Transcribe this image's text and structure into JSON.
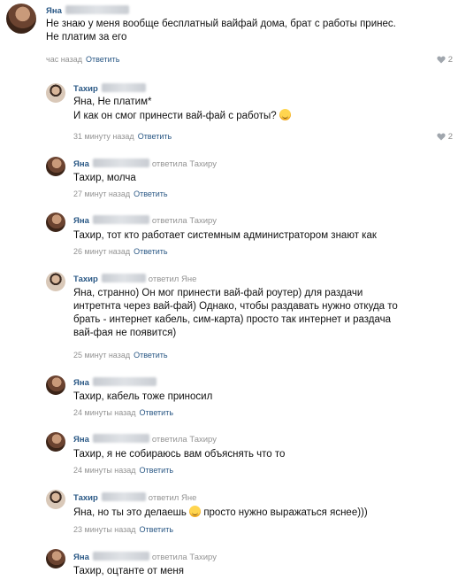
{
  "comments": [
    {
      "author": "Яна",
      "lines": [
        "Не знаю у меня вообще бесплатный вайфай дома, брат с работы принес.",
        "Не платим за его"
      ],
      "time": "час назад",
      "reply_label": "Ответить",
      "likes": "2"
    },
    {
      "author": "Тахир",
      "lines": [
        "Яна, Не платим*",
        "И как он смог принести вай-фай с работы?"
      ],
      "time": "31 минуту назад",
      "reply_label": "Ответить",
      "likes": "2"
    },
    {
      "author": "Яна",
      "replied_to": "ответила Тахиру",
      "lines": [
        "Тахир, молча"
      ],
      "time": "27 минут назад",
      "reply_label": "Ответить"
    },
    {
      "author": "Яна",
      "replied_to": "ответила Тахиру",
      "lines": [
        "Тахир, тот кто работает системным администратором знают как"
      ],
      "time": "26 минут назад",
      "reply_label": "Ответить"
    },
    {
      "author": "Тахир",
      "replied_to": "ответил Яне",
      "lines": [
        "Яна, странно) Он мог принести вай-фай роутер) для раздачи",
        "интретнта через вай-фай) Однако, чтобы раздавать нужно откуда то",
        "брать - интернет кабель, сим-карта) просто так интернет и раздача",
        "вай-фая не появится)"
      ],
      "time": "25 минут назад",
      "reply_label": "Ответить"
    },
    {
      "author": "Яна",
      "lines": [
        "Тахир, кабель тоже приносил"
      ],
      "time": "24 минуты назад",
      "reply_label": "Ответить"
    },
    {
      "author": "Яна",
      "replied_to": "ответила Тахиру",
      "lines": [
        "Тахир, я не собираюсь вам объяснять что то"
      ],
      "time": "24 минуты назад",
      "reply_label": "Ответить"
    },
    {
      "author": "Тахир",
      "replied_to": "ответил Яне",
      "line_before_emoji": "Яна, но ты это делаешь",
      "line_after_emoji": "просто нужно выражаться яснее)))",
      "time": "23 минуты назад",
      "reply_label": "Ответить"
    },
    {
      "author": "Яна",
      "replied_to": "ответила Тахиру",
      "lines": [
        "Тахир, оцтанте от меня"
      ]
    }
  ]
}
